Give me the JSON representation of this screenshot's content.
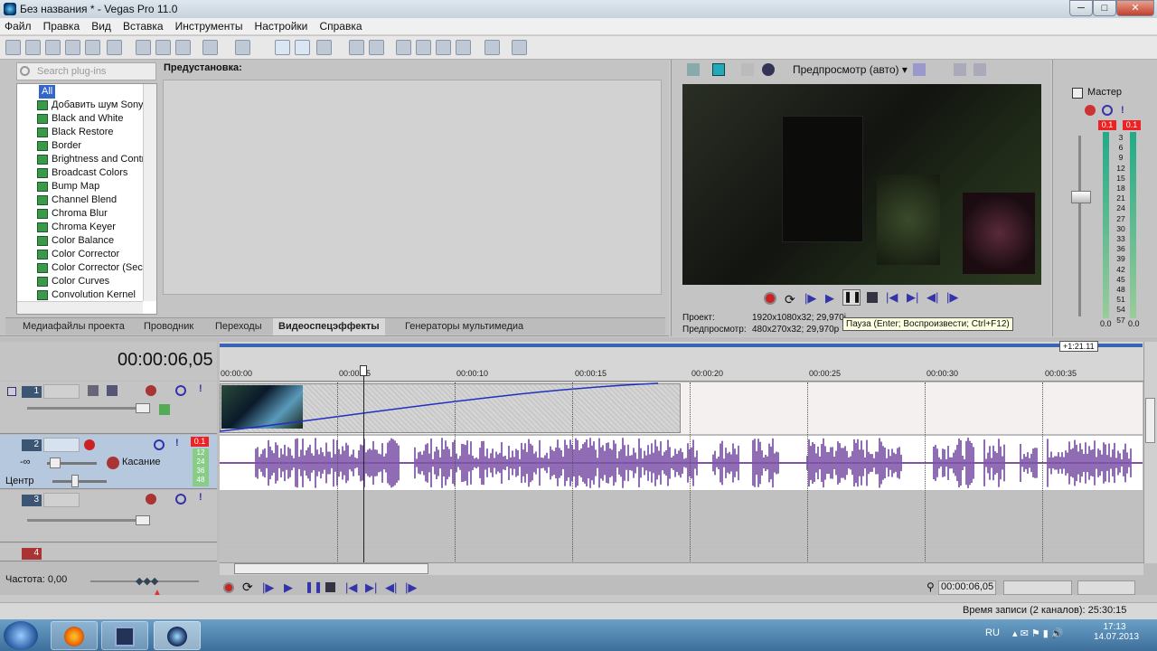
{
  "window": {
    "title": "Без названия * - Vegas Pro 11.0"
  },
  "menu": [
    "Файл",
    "Правка",
    "Вид",
    "Вставка",
    "Инструменты",
    "Настройки",
    "Справка"
  ],
  "plugins": {
    "search_placeholder": "Search plug-ins",
    "root": "All",
    "items": [
      "Добавить шум Sony",
      "Black and White",
      "Black Restore",
      "Border",
      "Brightness and Contrast",
      "Broadcast Colors",
      "Bump Map",
      "Channel Blend",
      "Chroma Blur",
      "Chroma Keyer",
      "Color Balance",
      "Color Corrector",
      "Color Corrector (Secondary)",
      "Color Curves",
      "Convolution Kernel"
    ],
    "presets_label": "Предустановка:"
  },
  "tabs": [
    "Медиафайлы проекта",
    "Проводник",
    "Переходы",
    "Видеоспецэффекты",
    "Генераторы мультимедиа"
  ],
  "active_tab": "Видеоспецэффекты",
  "preview": {
    "mode": "Предпросмотр (авто)",
    "project_label": "Проект:",
    "project_value": "1920x1080x32; 29,970i",
    "preview_label": "Предпросмотр:",
    "preview_value": "480x270x32; 29,970p",
    "tooltip": "Пауза (Enter; Воспроизвести; Ctrl+F12)"
  },
  "mixer": {
    "title": "Мастер",
    "peak_left": "0.1",
    "peak_right": "0.1",
    "scale": [
      "3",
      "6",
      "9",
      "12",
      "15",
      "18",
      "21",
      "24",
      "27",
      "30",
      "33",
      "36",
      "39",
      "42",
      "45",
      "48",
      "51",
      "54",
      "57"
    ],
    "bottom_left": "0.0",
    "bottom_right": "0.0"
  },
  "timeline": {
    "timecode": "00:00:06,05",
    "end_marker": "+1:21.11",
    "ruler": [
      "00:00:00",
      "00:00:05",
      "00:00:10",
      "00:00:15",
      "00:00:20",
      "00:00:25",
      "00:00:30",
      "00:00:35"
    ],
    "tracks": [
      {
        "num": "1",
        "type": "video"
      },
      {
        "num": "2",
        "type": "audio",
        "vol": "-∞",
        "pan": "Центр",
        "mode": "Касание",
        "peak": "0.1"
      },
      {
        "num": "3",
        "type": "video"
      },
      {
        "num": "4",
        "type": "audio"
      }
    ],
    "meter_labels": [
      "12",
      "24",
      "36",
      "48"
    ],
    "rate_label": "Частота: 0,00",
    "transport_time": "00:00:06,05",
    "status": "Время записи (2 каналов): 25:30:15"
  },
  "taskbar": {
    "lang": "RU",
    "time": "17:13",
    "date": "14.07.2013"
  }
}
